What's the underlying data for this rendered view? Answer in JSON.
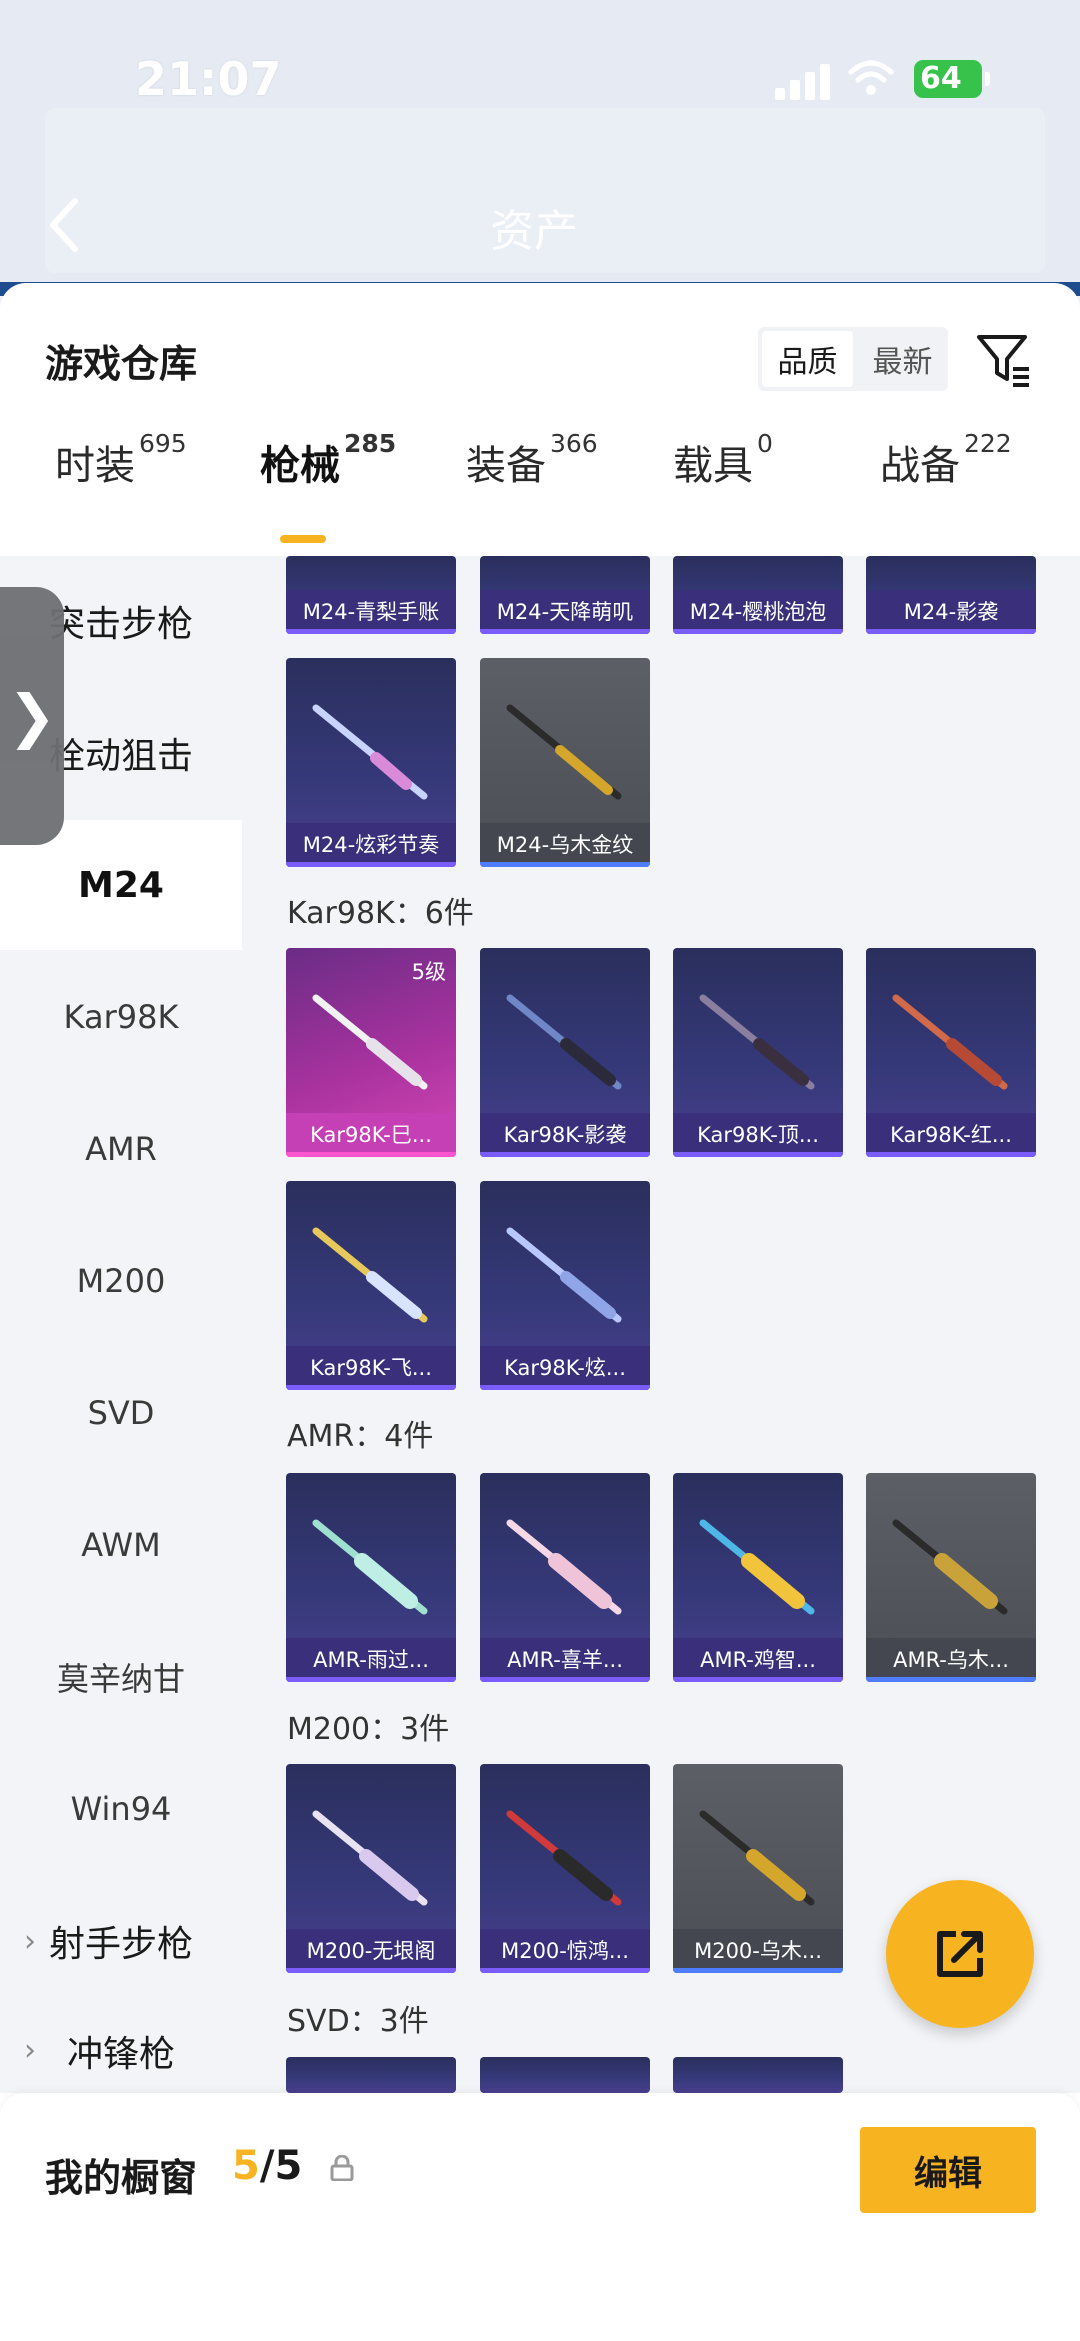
{
  "status": {
    "time": "21:07",
    "battery": "64"
  },
  "background_nav": {
    "title": "资产"
  },
  "sheet": {
    "title": "游戏仓库",
    "sort": [
      "品质",
      "最新"
    ]
  },
  "tabs": [
    {
      "label": "时装",
      "count": "695"
    },
    {
      "label": "枪械",
      "count": "285"
    },
    {
      "label": "装备",
      "count": "366"
    },
    {
      "label": "载具",
      "count": "0"
    },
    {
      "label": "战备",
      "count": "222"
    }
  ],
  "side": {
    "items": [
      "突击步枪",
      "栓动狙击",
      "M24",
      "Kar98K",
      "AMR",
      "M200",
      "SVD",
      "AWM",
      "莫辛纳甘",
      "Win94",
      "射手步枪",
      "冲锋枪"
    ]
  },
  "grid": {
    "m24_row1": [
      "M24-青梨手账",
      "M24-天降萌叽",
      "M24-樱桃泡泡",
      "M24-影袭"
    ],
    "m24_row2": [
      "M24-炫彩节奏",
      "M24-乌木金纹"
    ],
    "kar_header": "Kar98K：6件",
    "kar": [
      "Kar98K-巳...",
      "Kar98K-影袭",
      "Kar98K-顶...",
      "Kar98K-红...",
      "Kar98K-飞...",
      "Kar98K-炫..."
    ],
    "kar_level": "5级",
    "amr_header": "AMR：4件",
    "amr": [
      "AMR-雨过...",
      "AMR-喜羊...",
      "AMR-鸡智...",
      "AMR-乌木..."
    ],
    "m200_header": "M200：3件",
    "m200": [
      "M200-无垠阁",
      "M200-惊鸿...",
      "M200-乌木..."
    ],
    "svd_header": "SVD：3件"
  },
  "bottom": {
    "title": "我的橱窗",
    "current": "5",
    "total": "/5",
    "edit": "编辑"
  },
  "colors": {
    "accent": "#f8b321",
    "card_purple": "#3a2f7a",
    "card_gold": "#444750",
    "card_pink": "#c540b4"
  }
}
